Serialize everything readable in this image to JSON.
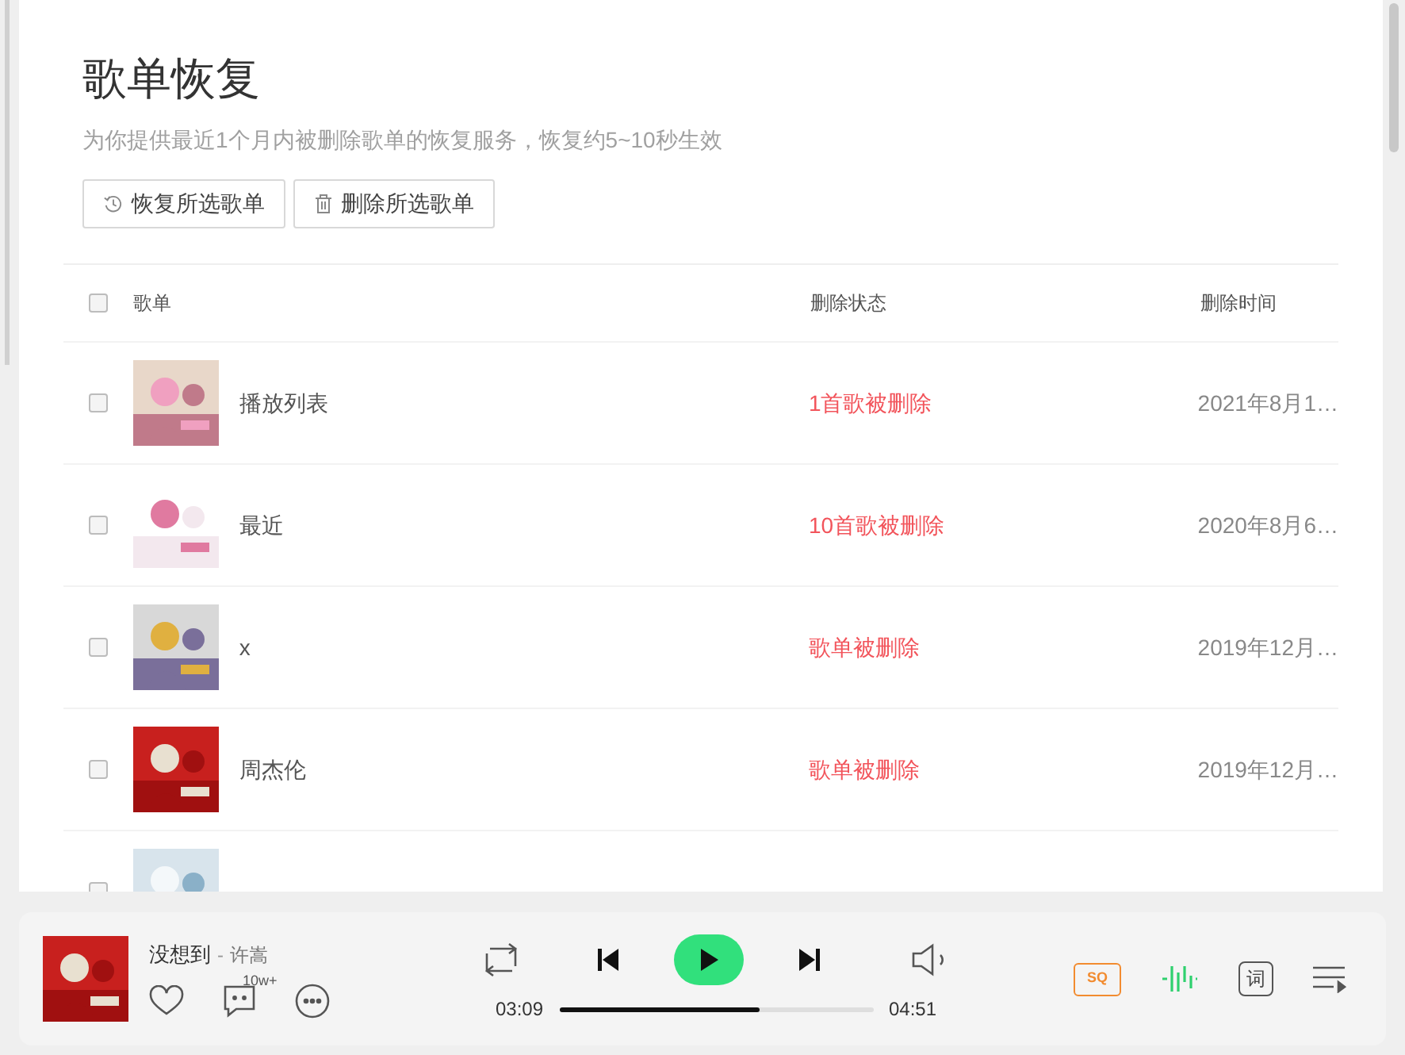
{
  "header": {
    "title": "歌单恢复",
    "subtitle": "为你提供最近1个月内被删除歌单的恢复服务，恢复约5~10秒生效"
  },
  "actions": [
    {
      "kind": "restore",
      "label": "恢复所选歌单"
    },
    {
      "kind": "delete",
      "label": "删除所选歌单"
    }
  ],
  "table": {
    "select_all": {
      "checked": false
    },
    "columns": [
      "歌单",
      "删除状态",
      "删除时间"
    ],
    "rows": [
      {
        "checked": false,
        "name": "播放列表",
        "status": "1首歌被删除",
        "time": "2021年8月1…"
      },
      {
        "checked": false,
        "name": "最近",
        "status": "10首歌被删除",
        "time": "2020年8月6…"
      },
      {
        "checked": false,
        "name": "x",
        "status": "歌单被删除",
        "time": "2019年12月…"
      },
      {
        "checked": false,
        "name": "周杰伦",
        "status": "歌单被删除",
        "time": "2019年12月…"
      },
      {
        "checked": false
      }
    ]
  },
  "player": {
    "song": "没想到",
    "separator": "-",
    "artist": "许嵩",
    "comment_count": "10w+",
    "elapsed": "03:09",
    "duration": "04:51",
    "level": 0.64,
    "playing": false,
    "quality": "SQ",
    "lyrics": "词"
  }
}
